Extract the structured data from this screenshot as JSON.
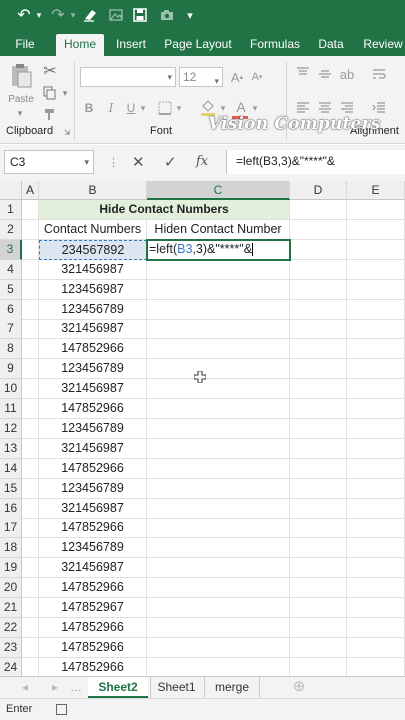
{
  "tabs": [
    "File",
    "Home",
    "Insert",
    "Page Layout",
    "Formulas",
    "Data",
    "Review"
  ],
  "active_tab": "Home",
  "ribbon": {
    "font_size": "12",
    "groups": [
      "Clipboard",
      "Font",
      "Alignment"
    ],
    "paste_label": "Paste",
    "watermark": "Vision Computers"
  },
  "formula_bar": {
    "name_box": "C3",
    "fx": "fx",
    "formula": "=left(B3,3)&\"****\"&"
  },
  "columns": [
    "A",
    "B",
    "C",
    "D",
    "E"
  ],
  "rows": [
    "1",
    "2",
    "3",
    "4",
    "5",
    "6",
    "7",
    "8",
    "9",
    "10",
    "11",
    "12",
    "13",
    "14",
    "15",
    "16",
    "17",
    "18",
    "19",
    "20",
    "21",
    "22",
    "23",
    "24"
  ],
  "sheet": {
    "title": "Hide Contact Numbers",
    "header_b": "Contact Numbers",
    "header_c": "Hiden Contact Number",
    "edit_prefix": "=left(",
    "edit_ref": "B3",
    "edit_suffix": ",3)&\"****\"&",
    "values": [
      "234567892",
      "321456987",
      "123456987",
      "123456789",
      "321456987",
      "147852966",
      "123456789",
      "321456987",
      "147852966",
      "123456789",
      "321456987",
      "147852966",
      "123456789",
      "321456987",
      "147852966",
      "123456789",
      "321456987",
      "147852966",
      "147852967",
      "147852966",
      "147852966",
      "147852966"
    ]
  },
  "sheet_tabs": [
    "Sheet2",
    "Sheet1",
    "merge"
  ],
  "active_sheet": "Sheet2",
  "status": "Enter",
  "colors": {
    "excel_green": "#217346",
    "title_fill": "#e2efda",
    "selected_cell": "#dce6f1"
  }
}
